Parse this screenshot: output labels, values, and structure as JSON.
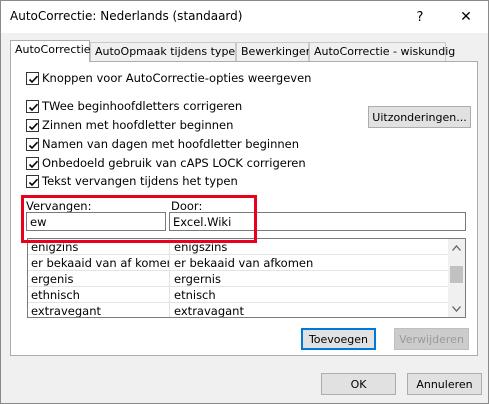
{
  "window": {
    "title": "AutoCorrectie: Nederlands (standaard)",
    "help_glyph": "?",
    "close_glyph": "✕"
  },
  "tabs": [
    {
      "label": "AutoCorrectie",
      "active": true
    },
    {
      "label": "AutoOpmaak tijdens typen",
      "active": false
    },
    {
      "label": "Bewerkingen",
      "active": false
    },
    {
      "label": "AutoCorrectie - wiskundig",
      "active": false
    }
  ],
  "options": {
    "show_buttons": {
      "label": "Knoppen voor AutoCorrectie-opties weergeven",
      "checked": true
    },
    "two_initial_caps": {
      "label": "TWee beginhoofdletters corrigeren",
      "checked": true
    },
    "capitalize_sentences": {
      "label": "Zinnen met hoofdletter beginnen",
      "checked": true
    },
    "capitalize_days": {
      "label": "Namen van dagen met hoofdletter beginnen",
      "checked": true
    },
    "caps_lock": {
      "label": "Onbedoeld gebruik van cAPS LOCK corrigeren",
      "checked": true
    },
    "replace_text": {
      "label": "Tekst vervangen tijdens het typen",
      "checked": true
    }
  },
  "exceptions_button": "Uitzonderingen...",
  "replace": {
    "replace_label": "Vervangen:",
    "with_label": "Door:",
    "replace_value": "ew",
    "with_value": "Excel.Wiki"
  },
  "entries": [
    {
      "from": "enigzins",
      "to": "enigszins"
    },
    {
      "from": "er bekaaid van af komen",
      "to": "er bekaaid van afkomen"
    },
    {
      "from": "ergenis",
      "to": "ergernis"
    },
    {
      "from": "ethnisch",
      "to": "etnisch"
    },
    {
      "from": "extravegant",
      "to": "extravagant"
    }
  ],
  "buttons": {
    "add": "Toevoegen",
    "delete": "Verwijderen",
    "ok": "OK",
    "cancel": "Annuleren"
  },
  "colors": {
    "highlight": "#e8001c",
    "accent": "#0078d7"
  }
}
